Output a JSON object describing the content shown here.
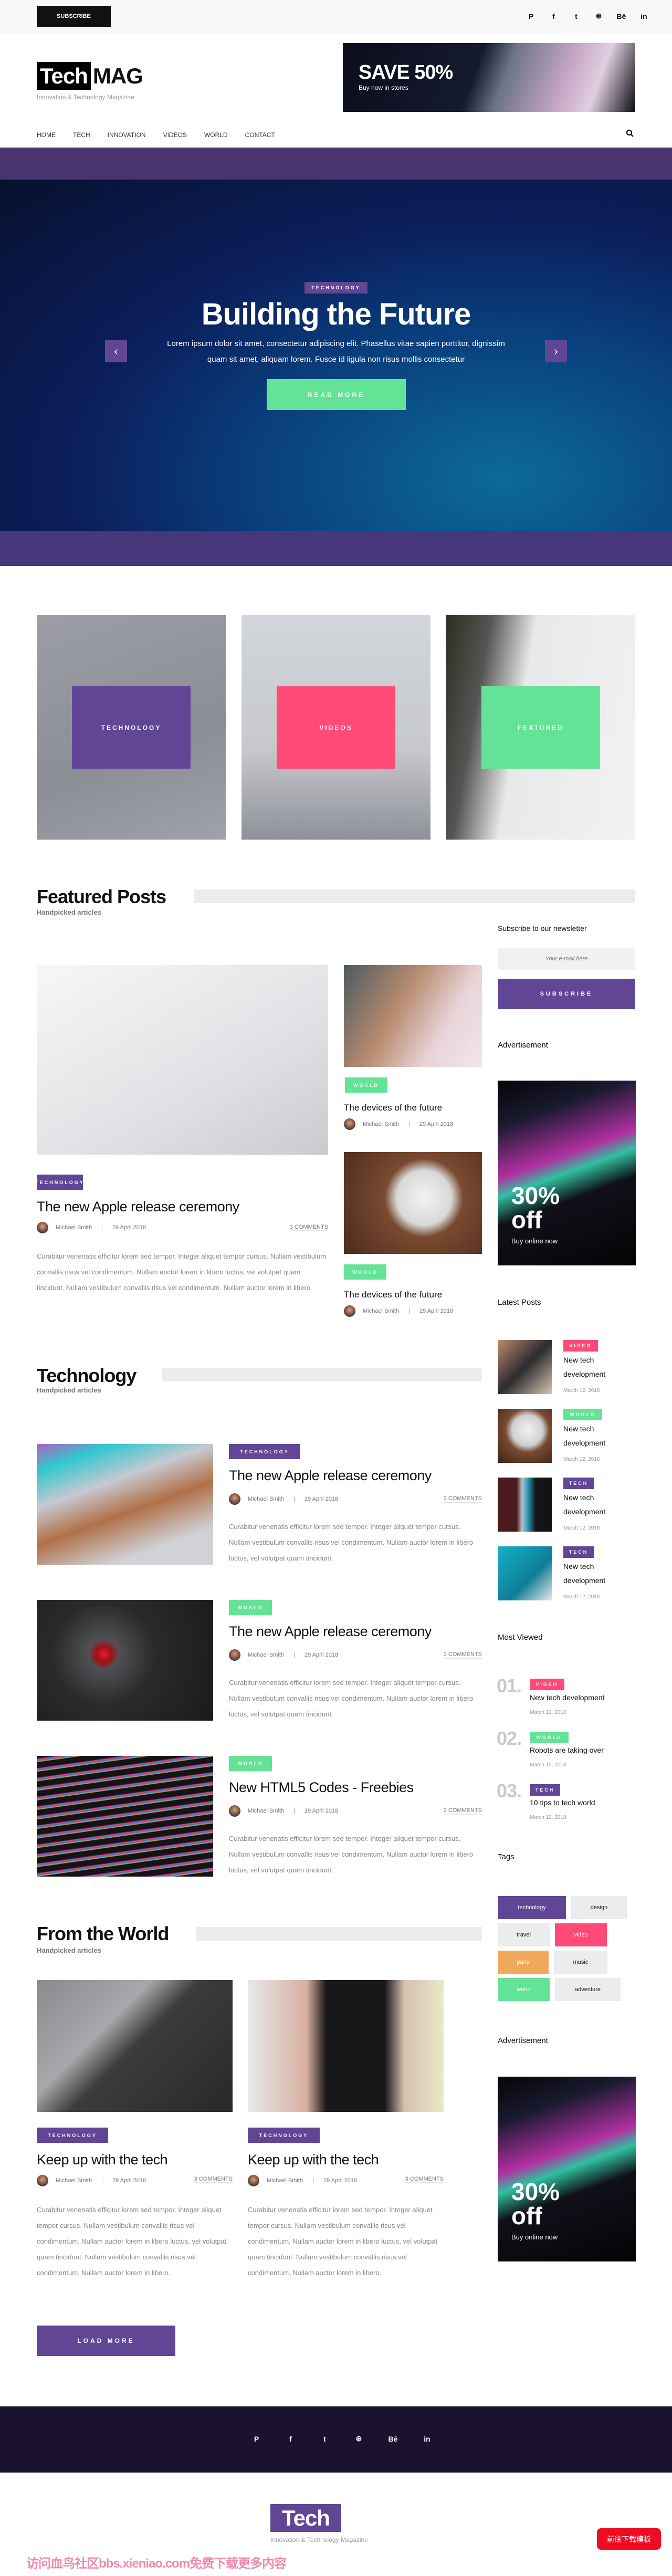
{
  "topbar": {
    "subscribe": "SUBSCRIBE",
    "social": [
      "P",
      "f",
      "t",
      "⊛",
      "Bē",
      "in"
    ]
  },
  "logo": {
    "tech": "Tech",
    "mag": "MAG",
    "tagline": "Innovation & Technology Magazine"
  },
  "banner": {
    "headline": "SAVE 50%",
    "sub": "Buy now in stores"
  },
  "nav": {
    "items": [
      "HOME",
      "TECH",
      "INNOVATION",
      "VIDEOS",
      "WORLD",
      "CONTACT"
    ],
    "search_icon": "search-icon"
  },
  "hero": {
    "tag": "TECHNOLOGY",
    "title": "Building the Future",
    "text": "Lorem ipsum dolor sit amet, consectetur adipiscing elit. Phasellus vitae sapien porttitor, dignissim quam sit amet, aliquam lorem. Fusce id ligula non risus mollis consectetur",
    "button": "READ MORE",
    "prev": "‹",
    "next": "›"
  },
  "tiles": [
    "TECHNOLOGY",
    "VIDEOS",
    "FEATURED"
  ],
  "colors": {
    "purple": "#624696",
    "pink": "#ff4a78",
    "green": "#62e396",
    "orange": "#f0a85a",
    "footer": "#1b1230",
    "band": "#4a3470"
  },
  "featured": {
    "title": "Featured Posts",
    "subtitle": "Handpicked articles",
    "main": {
      "tag": "TECHNOLOGY",
      "title": "The new Apple release ceremony",
      "author": "Michael Smith",
      "date": "29 April 2018",
      "comments": "3 COMMENTS",
      "text": "Curabitur venenatis efficitur lorem sed tempor. Integer aliquet tempor cursus. Nullam vestibulum convallis risus vel condimentum. Nullam auctor lorem in libero luctus, vel volutpat quam tincidunt. Nullam vestibulum convallis risus vel condimentum. Nullam auctor lorem in libero."
    },
    "side": [
      {
        "tag": "WORLD",
        "title": "The devices of the future",
        "author": "Michael Smith",
        "date": "29 April 2018"
      },
      {
        "tag": "WORLD",
        "title": "The devices of the future",
        "author": "Michael Smith",
        "date": "29 April 2018"
      }
    ]
  },
  "sidebar": {
    "newsletter_title": "Subscribe to our newsletter",
    "email_placeholder": "Your e-mail here",
    "subscribe": "SUBSCRIBE",
    "ad_title": "Advertisement",
    "ad": {
      "big1": "30%",
      "big2": "off",
      "sub": "Buy online now"
    },
    "latest_title": "Latest Posts",
    "latest": [
      {
        "tag": "VIDEO",
        "title": "New tech development",
        "date": "March 12, 2018"
      },
      {
        "tag": "WORLD",
        "title": "New tech development",
        "date": "March 12, 2018"
      },
      {
        "tag": "TECH",
        "title": "New tech development",
        "date": "March 12, 2018"
      },
      {
        "tag": "TECH",
        "title": "New tech development",
        "date": "March 12, 2018"
      }
    ],
    "most_title": "Most Viewed",
    "most": [
      {
        "num": "01.",
        "tag": "VIDEO",
        "title": "New tech development",
        "date": "March 12, 2018"
      },
      {
        "num": "02.",
        "tag": "WORLD",
        "title": "Robots are taking over",
        "date": "March 12, 2018"
      },
      {
        "num": "03.",
        "tag": "TECH",
        "title": "10 tips to tech world",
        "date": "March 12, 2018"
      }
    ],
    "tags_title": "Tags",
    "tags": [
      "technology",
      "design",
      "travel",
      "video",
      "party",
      "music",
      "world",
      "adventure"
    ],
    "ad2_title": "Advertisement",
    "ad2": {
      "big1": "30%",
      "big2": "off",
      "sub": "Buy online now"
    }
  },
  "technology": {
    "title": "Technology",
    "subtitle": "Handpicked articles",
    "posts": [
      {
        "tag": "TECHNOLOGY",
        "title": "The new Apple release ceremony",
        "author": "Michael Smith",
        "date": "29 April 2018",
        "comments": "3 COMMENTS",
        "text": "Curabitur venenatis efficitur lorem sed tempor. Integer aliquet tempor cursus. Nullam vestibulum convallis risus vel condimentum. Nullam auctor lorem in libero luctus, vel volutpat quam tincidunt."
      },
      {
        "tag": "WORLD",
        "title": "The new Apple release ceremony",
        "author": "Michael Smith",
        "date": "29 April 2018",
        "comments": "3 COMMENTS",
        "text": "Curabitur venenatis efficitur lorem sed tempor. Integer aliquet tempor cursus. Nullam vestibulum convallis risus vel condimentum. Nullam auctor lorem in libero luctus, vel volutpat quam tincidunt."
      },
      {
        "tag": "WORLD",
        "title": "New HTML5 Codes - Freebies",
        "author": "Michael Smith",
        "date": "29 April 2018",
        "comments": "3 COMMENTS",
        "text": "Curabitur venenatis efficitur lorem sed tempor. Integer aliquet tempor cursus. Nullam vestibulum convallis risus vel condimentum. Nullam auctor lorem in libero luctus, vel volutpat quam tincidunt."
      }
    ]
  },
  "world": {
    "title": "From the World",
    "subtitle": "Handpicked articles",
    "posts": [
      {
        "tag": "TECHNOLOGY",
        "title": "Keep up with the tech",
        "author": "Michael Smith",
        "date": "29 April 2018",
        "comments": "3 COMMENTS",
        "text": "Curabitur venenatis efficitur lorem sed tempor. Integer aliquet tempor cursus. Nullam vestibulum convallis risus vel condimentum. Nullam auctor lorem in libero luctus, vel volutpat quam tincidunt. Nullam vestibulum convallis risus vel condimentum. Nullam auctor lorem in libero."
      },
      {
        "tag": "TECHNOLOGY",
        "title": "Keep up with the tech",
        "author": "Michael Smith",
        "date": "29 April 2018",
        "comments": "3 COMMENTS",
        "text": "Curabitur venenatis efficitur lorem sed tempor. Integer aliquet tempor cursus. Nullam vestibulum convallis risus vel condimentum. Nullam auctor lorem in libero luctus, vel volutpat quam tincidunt. Nullam vestibulum convallis risus vel condimentum. Nullam auctor lorem in libero."
      }
    ],
    "load_more": "LOAD MORE"
  },
  "footer": {
    "social": [
      "P",
      "f",
      "t",
      "⊛",
      "Bē",
      "in"
    ],
    "logo": "Tech",
    "tagline": "Innovation & Technology Magazine"
  },
  "overlay": {
    "watermark": "访问血鸟社区bbs.xieniao.com免费下载更多内容",
    "download_button": "前往下载模板"
  }
}
